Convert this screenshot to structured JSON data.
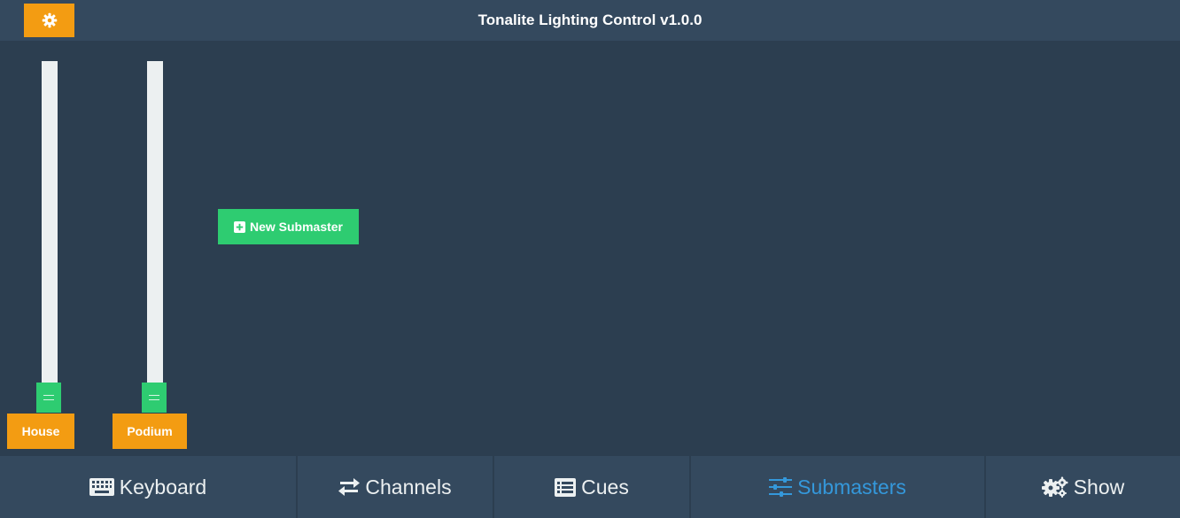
{
  "header": {
    "title": "Tonalite Lighting Control v1.0.0",
    "settings_icon": "gear-icon"
  },
  "faders": [
    {
      "label": "House",
      "level": 0
    },
    {
      "label": "Podium",
      "level": 0
    }
  ],
  "new_submaster": {
    "label": "New Submaster",
    "icon": "plus-square-icon"
  },
  "nav": {
    "items": [
      {
        "label": "Keyboard",
        "icon": "keyboard-icon",
        "active": false
      },
      {
        "label": "Channels",
        "icon": "exchange-icon",
        "active": false
      },
      {
        "label": "Cues",
        "icon": "list-icon",
        "active": false
      },
      {
        "label": "Submasters",
        "icon": "sliders-icon",
        "active": true
      },
      {
        "label": "Show",
        "icon": "cogs-icon",
        "active": false
      }
    ]
  },
  "colors": {
    "background": "#2c3e50",
    "header": "#34495e",
    "accent_orange": "#f39c12",
    "accent_green": "#2ecc71",
    "active_blue": "#3498db",
    "track": "#ecf0f1"
  }
}
